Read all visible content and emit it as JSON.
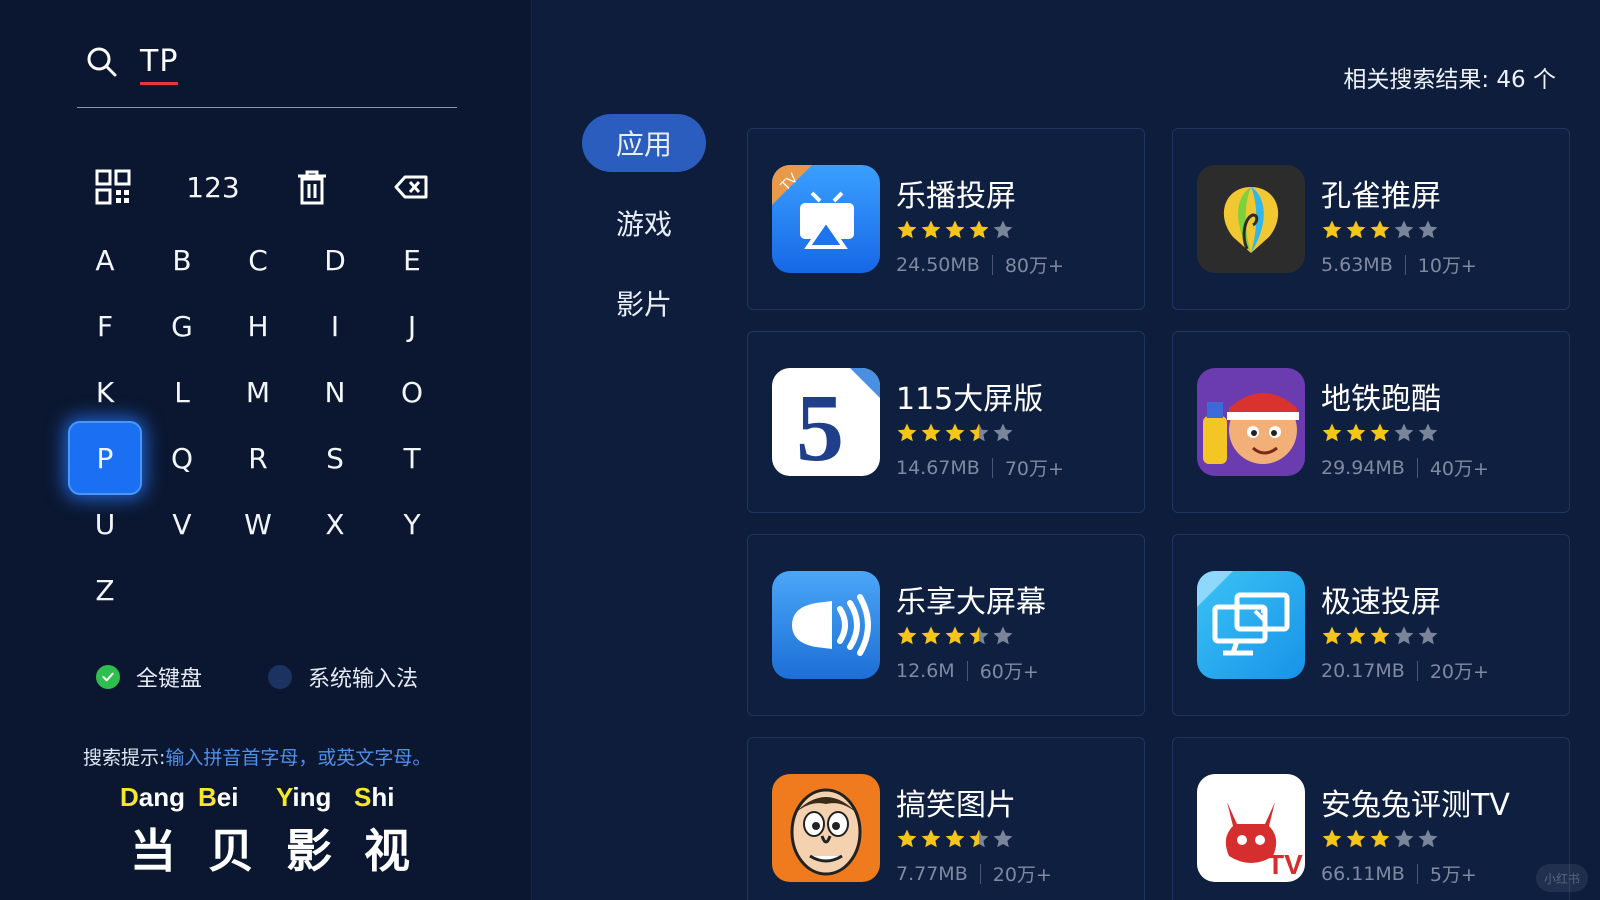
{
  "search": {
    "query": "TP"
  },
  "keypad": {
    "top_keys": [
      "qrcode-icon",
      "123",
      "trash-icon",
      "backspace-icon"
    ],
    "letters": [
      "A",
      "B",
      "C",
      "D",
      "E",
      "F",
      "G",
      "H",
      "I",
      "J",
      "K",
      "L",
      "M",
      "N",
      "O",
      "P",
      "Q",
      "R",
      "S",
      "T",
      "U",
      "V",
      "W",
      "X",
      "Y",
      "Z"
    ],
    "selected": "P"
  },
  "input_modes": [
    {
      "label": "全键盘",
      "selected": true
    },
    {
      "label": "系统输入法",
      "selected": false
    }
  ],
  "hint": {
    "label": "搜索提示:",
    "text": "输入拼音首字母，或英文字母。"
  },
  "brand": {
    "pinyin": [
      "Dang",
      "Bei",
      "Ying",
      "Shi"
    ],
    "hanzi": [
      "当",
      "贝",
      "影",
      "视"
    ]
  },
  "tabs": [
    {
      "label": "应用",
      "active": true
    },
    {
      "label": "游戏",
      "active": false
    },
    {
      "label": "影片",
      "active": false
    }
  ],
  "results": {
    "label": "相关搜索结果: 46 个"
  },
  "apps": [
    {
      "name": "乐播投屏",
      "rating": 4,
      "size": "24.50MB",
      "downloads": "80万+",
      "icon": "lebo-cast-icon"
    },
    {
      "name": "孔雀推屏",
      "rating": 3,
      "size": "5.63MB",
      "downloads": "10万+",
      "icon": "peacock-icon"
    },
    {
      "name": "115大屏版",
      "rating": 3.5,
      "size": "14.67MB",
      "downloads": "70万+",
      "icon": "number-5-icon"
    },
    {
      "name": "地铁跑酷",
      "rating": 3,
      "size": "29.94MB",
      "downloads": "40万+",
      "icon": "subway-surfer-icon"
    },
    {
      "name": "乐享大屏幕",
      "rating": 3.5,
      "size": "12.6M",
      "downloads": "60万+",
      "icon": "sound-wave-icon"
    },
    {
      "name": "极速投屏",
      "rating": 3,
      "size": "20.17MB",
      "downloads": "20万+",
      "icon": "screen-cast-icon"
    },
    {
      "name": "搞笑图片",
      "rating": 3.5,
      "size": "7.77MB",
      "downloads": "20万+",
      "icon": "funny-face-icon"
    },
    {
      "name": "安兔兔评测TV",
      "rating": 3,
      "size": "66.11MB",
      "downloads": "5万+",
      "icon": "antutu-icon"
    }
  ],
  "colors": {
    "accent": "#1a6ff2",
    "star": "#f5c518",
    "star_empty": "#7a8599",
    "brand_cap": "#f5e72a"
  },
  "watermark": "小红书"
}
